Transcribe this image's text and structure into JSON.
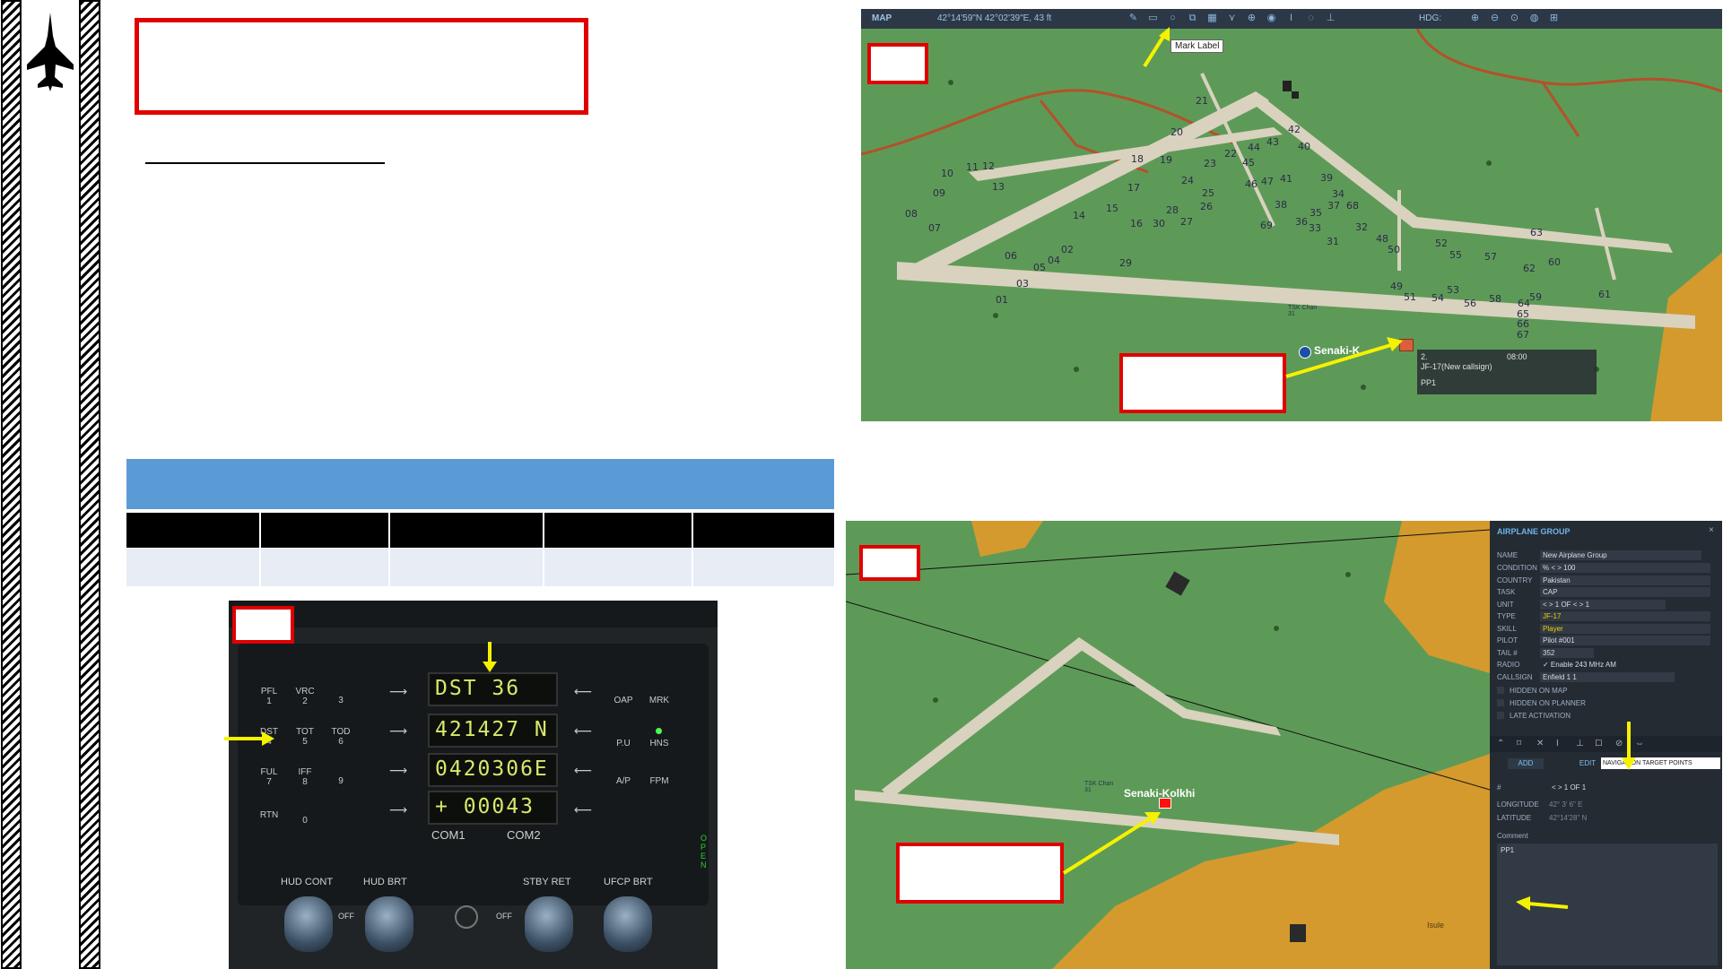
{
  "aircraft_icon": "jet-silhouette-icon",
  "colors": {
    "accent_red": "#e00000",
    "table_header_blue": "#5b9bd5",
    "arrow_yellow": "#f5f200"
  },
  "map": {
    "title": "MAP",
    "coords": "42°14'59\"N 42°02'39\"E, 43 ft",
    "hdg_label": "HDG:",
    "tooltip": "Mark Label",
    "airfield_label": "Senaki-K",
    "tsk_label": "TSK Chan 31",
    "unit_popup": {
      "line1": "2.",
      "time": "08:00",
      "line2": "JF-17(New callsign)",
      "line3": "PP1"
    },
    "parking_numbers": [
      "21",
      "20",
      "19",
      "18",
      "17",
      "16",
      "15",
      "14",
      "13",
      "12",
      "11",
      "10",
      "09",
      "08",
      "07",
      "06",
      "05",
      "04",
      "03",
      "02",
      "01",
      "22",
      "23",
      "24",
      "25",
      "26",
      "27",
      "28",
      "29",
      "30",
      "31",
      "32",
      "33",
      "34",
      "35",
      "36",
      "37",
      "38",
      "39",
      "40",
      "41",
      "42",
      "43",
      "44",
      "45",
      "46",
      "47",
      "48",
      "49",
      "50",
      "51",
      "52",
      "53",
      "54",
      "55",
      "56",
      "57",
      "58",
      "59",
      "60",
      "61",
      "62",
      "63",
      "64",
      "65",
      "66",
      "67",
      "68",
      "69"
    ]
  },
  "ufcp": {
    "displays": [
      "DST   36",
      "421427 N",
      "0420306E",
      "+  00043"
    ],
    "left_keys": [
      [
        "PFL",
        "1"
      ],
      [
        "VRC",
        "2"
      ],
      [
        "",
        "3"
      ],
      [
        "DST",
        "4"
      ],
      [
        "TOT",
        "5"
      ],
      [
        "TOD",
        "6"
      ],
      [
        "FUL",
        "7"
      ],
      [
        "IFF",
        "8"
      ],
      [
        "",
        "9"
      ],
      [
        "RTN",
        ""
      ],
      [
        "",
        "0"
      ],
      [
        "",
        ""
      ]
    ],
    "right_keys": [
      [
        "OAP"
      ],
      [
        "MRK"
      ],
      [
        "P.U"
      ],
      [
        "HNS"
      ],
      [
        "A/P"
      ],
      [
        "FPM"
      ]
    ],
    "com1": "COM1",
    "com2": "COM2",
    "open_label": "OPEN",
    "knobs": [
      "HUD CONT",
      "HUD BRT",
      "STBY RET",
      "UFCP BRT"
    ],
    "off": "OFF"
  },
  "editor": {
    "airfield_label": "Senaki-Kolkhi",
    "tsk_label": "TSK Chan 31",
    "isule": "Isule",
    "panel_title": "AIRPLANE GROUP",
    "fields": [
      {
        "label": "NAME",
        "value": "New Airplane Group"
      },
      {
        "label": "CONDITION",
        "value": "%  < >  100"
      },
      {
        "label": "COUNTRY",
        "value": "Pakistan"
      },
      {
        "label": "TASK",
        "value": "CAP"
      },
      {
        "label": "UNIT",
        "value": "< >  1       OF    < >  1"
      },
      {
        "label": "TYPE",
        "value": "JF-17"
      },
      {
        "label": "SKILL",
        "value": "Player"
      },
      {
        "label": "PILOT",
        "value": "Pilot #001"
      },
      {
        "label": "TAIL #",
        "value": "352"
      },
      {
        "label": "RADIO",
        "value": "✓ Enable          243    MHz   AM"
      },
      {
        "label": "CALLSIGN",
        "value": "Enfield        1      1"
      }
    ],
    "checks": [
      "HIDDEN ON MAP",
      "HIDDEN ON PLANNER",
      "LATE ACTIVATION"
    ],
    "add": "ADD",
    "edit": "EDIT",
    "nav_points": "NAVIGATION TARGET POINTS",
    "hash": "#",
    "hash_value": "< >  1        OF       1",
    "longitude_label": "LONGITUDE",
    "longitude": "42° 3' 6\" E",
    "latitude_label": "LATITUDE",
    "latitude": "42°14'28\" N",
    "comment_label": "Comment",
    "comment": "PP1"
  }
}
